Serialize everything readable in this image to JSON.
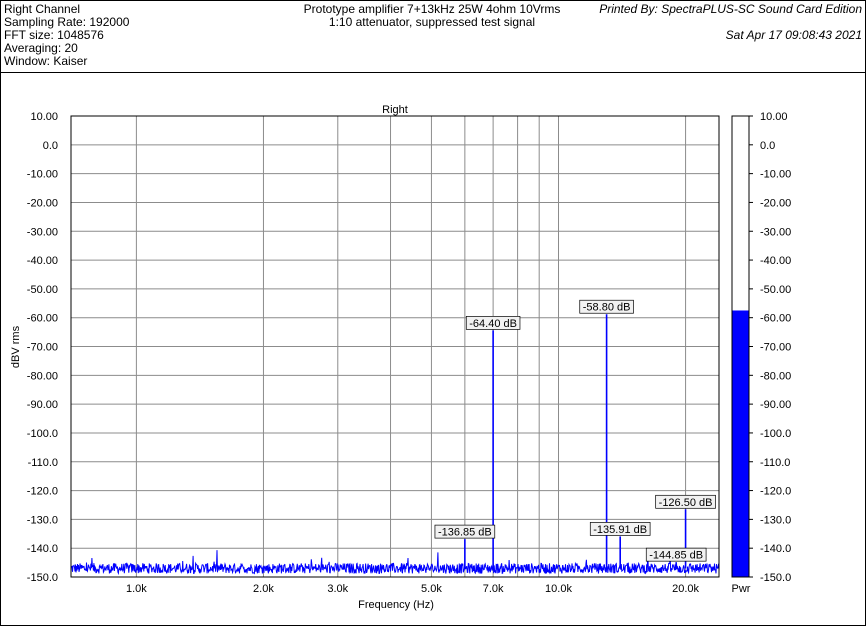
{
  "header": {
    "channel": "Right Channel",
    "sampling_rate": "Sampling Rate: 192000",
    "fft_size": "FFT size: 1048576",
    "averaging": "Averaging: 20",
    "window": "Window: Kaiser",
    "title_line1": "Prototype amplifier 7+13kHz 25W 4ohm 10Vrms",
    "title_line2": "1:10 attenuator, suppressed test signal",
    "printed_by": "Printed By: SpectraPLUS-SC Sound Card Edition",
    "date": "Sat Apr 17 09:08:43 2021"
  },
  "chart_data": {
    "type": "line",
    "title": "Right",
    "xlabel": "Frequency (Hz)",
    "ylabel": "dBV rms",
    "x_scale": "log",
    "xlim": [
      700,
      24000
    ],
    "ylim": [
      -150,
      10
    ],
    "x_ticks": [
      {
        "v": 1000,
        "label": "1.0k"
      },
      {
        "v": 2000,
        "label": "2.0k"
      },
      {
        "v": 3000,
        "label": "3.0k"
      },
      {
        "v": 5000,
        "label": "5.0k"
      },
      {
        "v": 7000,
        "label": "7.0k"
      },
      {
        "v": 10000,
        "label": "10.0k"
      },
      {
        "v": 20000,
        "label": "20.0k"
      }
    ],
    "x_gridlines": [
      1000,
      2000,
      3000,
      4000,
      5000,
      6000,
      7000,
      8000,
      9000,
      10000,
      20000
    ],
    "y_ticks": [
      10,
      0,
      -10,
      -20,
      -30,
      -40,
      -50,
      -60,
      -70,
      -80,
      -90,
      -100,
      -110,
      -120,
      -130,
      -140,
      -150
    ],
    "y_tick_labels": [
      "10.00",
      "0.0",
      "-10.00",
      "-20.00",
      "-30.00",
      "-40.00",
      "-50.00",
      "-60.00",
      "-70.00",
      "-80.00",
      "-90.00",
      "-100.0",
      "-110.0",
      "-120.0",
      "-130.0",
      "-140.0",
      "-150.0"
    ],
    "grid": true,
    "noise_floor": -147,
    "series": [
      {
        "color": "#0000ff",
        "peaks": [
          {
            "x": 6000,
            "y": -136.85,
            "label": "-136.85 dB"
          },
          {
            "x": 7000,
            "y": -64.4,
            "label": "-64.40 dB"
          },
          {
            "x": 13000,
            "y": -58.8,
            "label": "-58.80 dB"
          },
          {
            "x": 14000,
            "y": -135.91,
            "label": "-135.91 dB"
          },
          {
            "x": 19000,
            "y": -144.85,
            "label": "-144.85 dB"
          },
          {
            "x": 20000,
            "y": -126.5,
            "label": "-126.50 dB"
          }
        ]
      }
    ],
    "level_meter": {
      "label": "Pwr",
      "value": -57.5,
      "color": "#0000ff",
      "ylim": [
        -150,
        10
      ],
      "tick_labels": [
        "10.00",
        "0.0",
        "-10.00",
        "-20.00",
        "-30.00",
        "-40.00",
        "-50.00",
        "-60.00",
        "-70.00",
        "-80.00",
        "-90.00",
        "-100.0",
        "-110.0",
        "-120.0",
        "-130.0",
        "-140.0",
        "-150.0"
      ]
    }
  }
}
